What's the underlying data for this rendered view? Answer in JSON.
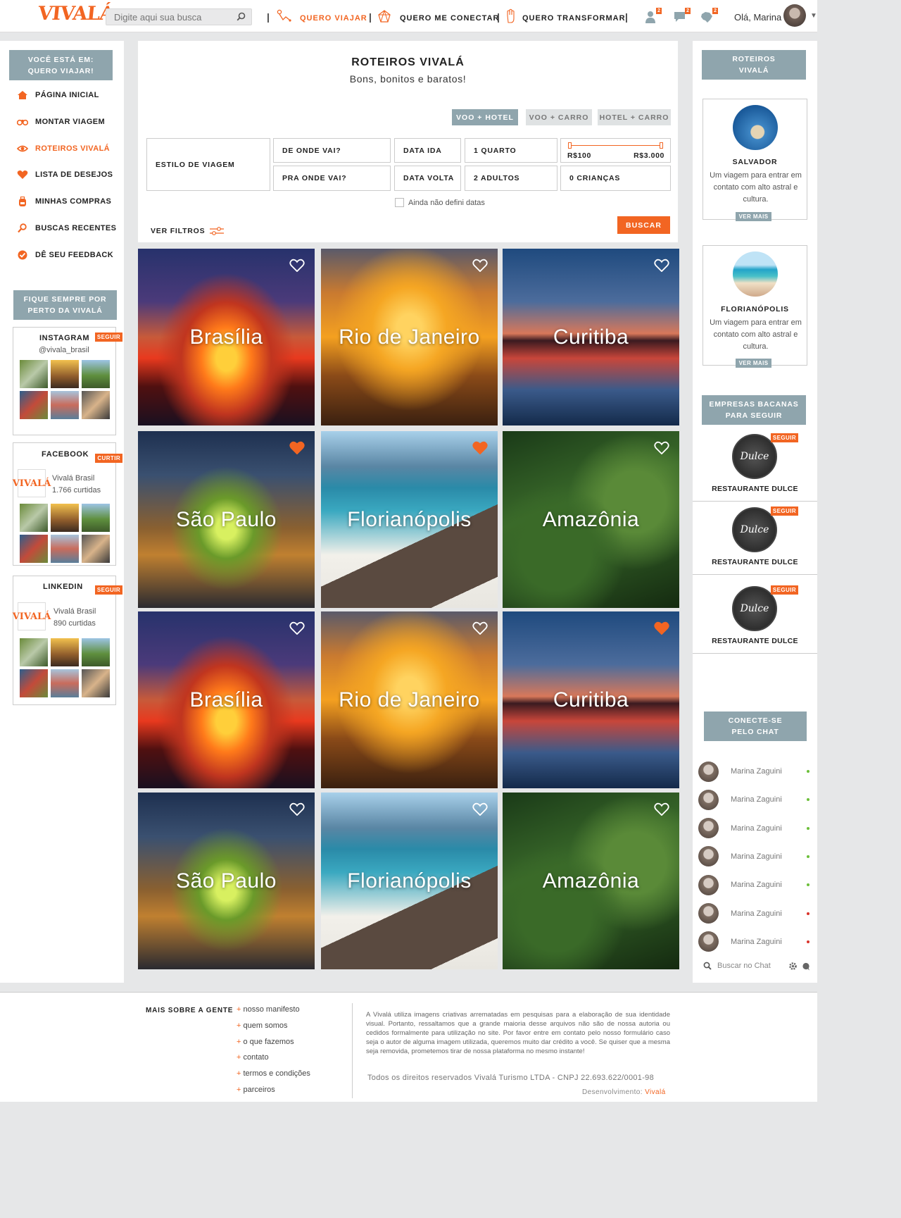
{
  "header": {
    "logo": "VIVALÁ",
    "search_placeholder": "Digite aqui sua busca",
    "nav": [
      {
        "label": "QUERO VIAJAR",
        "active": true
      },
      {
        "label": "QUERO ME CONECTAR",
        "active": false
      },
      {
        "label": "QUERO TRANSFORMAR",
        "active": false
      }
    ],
    "badges": [
      "2",
      "2",
      "2"
    ],
    "greeting": "Olá, Marina"
  },
  "left_sidebar": {
    "location_box": [
      "VOCÊ ESTÁ EM:",
      "QUERO VIAJAR!"
    ],
    "menu": [
      {
        "label": "PÁGINA INICIAL",
        "icon": "home-icon",
        "active": false
      },
      {
        "label": "MONTAR VIAGEM",
        "icon": "binoculars-icon",
        "active": false
      },
      {
        "label": "ROTEIROS VIVALÁ",
        "icon": "eye-icon",
        "active": true
      },
      {
        "label": "LISTA DE DESEJOS",
        "icon": "heart-icon",
        "active": false
      },
      {
        "label": "MINHAS COMPRAS",
        "icon": "backpack-icon",
        "active": false
      },
      {
        "label": "BUSCAS RECENTES",
        "icon": "search-icon",
        "active": false
      },
      {
        "label": "DÊ SEU FEEDBACK",
        "icon": "check-circle-icon",
        "active": false
      }
    ],
    "follow_box": [
      "FIQUE SEMPRE POR",
      "PERTO DA VIVALÁ"
    ],
    "instagram": {
      "title": "INSTAGRAM",
      "button": "SEGUIR",
      "handle": "@vivala_brasil"
    },
    "facebook": {
      "title": "FACEBOOK",
      "button": "CURTIR",
      "name": "Vivalá Brasil",
      "count": "1.766 curtidas",
      "logo": "VIVALÁ"
    },
    "linkedin": {
      "title": "LINKEDIN",
      "button": "SEGUIR",
      "name": "Vivalá Brasil",
      "count": "890 curtidas",
      "logo": "VIVALÁ"
    }
  },
  "main": {
    "title": "ROTEIROS VIVALÁ",
    "subtitle": "Bons, bonitos e baratos!",
    "tabs": [
      {
        "label": "VOO + HOTEL",
        "active": true
      },
      {
        "label": "VOO + CARRO",
        "active": false
      },
      {
        "label": "HOTEL + CARRO",
        "active": false
      }
    ],
    "fields": {
      "style": "ESTILO DE VIAGEM",
      "from": "DE ONDE VAI?",
      "to": "PRA ONDE VAI?",
      "date_out": "DATA IDA",
      "date_back": "DATA VOLTA",
      "rooms": "1 QUARTO",
      "adults": "2 ADULTOS",
      "children": "0 CRIANÇAS",
      "price_min": "R$100",
      "price_max": "R$3.000"
    },
    "no_dates": "Ainda não defini datas",
    "filters": "VER FILTROS",
    "search_button": "BUSCAR"
  },
  "destinations": [
    {
      "name": "Brasília",
      "fav": false
    },
    {
      "name": "Rio de Janeiro",
      "fav": false
    },
    {
      "name": "Curitiba",
      "fav": false
    },
    {
      "name": "São Paulo",
      "fav": true
    },
    {
      "name": "Florianópolis",
      "fav": true
    },
    {
      "name": "Amazônia",
      "fav": false
    },
    {
      "name": "Brasília",
      "fav": false
    },
    {
      "name": "Rio de Janeiro",
      "fav": false
    },
    {
      "name": "Curitiba",
      "fav": true
    },
    {
      "name": "São Paulo",
      "fav": false
    },
    {
      "name": "Florianópolis",
      "fav": false
    },
    {
      "name": "Amazônia",
      "fav": false
    }
  ],
  "right_sidebar": {
    "routes_box": [
      "ROTEIROS",
      "VIVALÁ"
    ],
    "routes": [
      {
        "name": "SALVADOR",
        "desc": "Um viagem para entrar em contato com alto astral e cultura.",
        "button": "VER MAIS"
      },
      {
        "name": "FLORIANÓPOLIS",
        "desc": "Um viagem para entrar em contato com alto astral e cultura.",
        "button": "VER MAIS"
      }
    ],
    "companies_box": [
      "EMPRESAS BACANAS",
      "PARA SEGUIR"
    ],
    "companies": [
      {
        "name": "RESTAURANTE DULCE",
        "button": "SEGUIR",
        "logo": "Dulce"
      },
      {
        "name": "RESTAURANTE DULCE",
        "button": "SEGUIR",
        "logo": "Dulce"
      },
      {
        "name": "RESTAURANTE DULCE",
        "button": "SEGUIR",
        "logo": "Dulce"
      }
    ],
    "chat_box": [
      "CONECTE-SE",
      "PELO CHAT"
    ],
    "chat_users": [
      {
        "name": "Marina Zaguini",
        "online": true
      },
      {
        "name": "Marina Zaguini",
        "online": true
      },
      {
        "name": "Marina Zaguini",
        "online": true
      },
      {
        "name": "Marina Zaguini",
        "online": true
      },
      {
        "name": "Marina Zaguini",
        "online": true
      },
      {
        "name": "Marina Zaguini",
        "online": false
      },
      {
        "name": "Marina Zaguini",
        "online": false
      }
    ],
    "chat_search": "Buscar no Chat"
  },
  "footer": {
    "title": "MAIS SOBRE A GENTE",
    "links": [
      "nosso manifesto",
      "quem somos",
      "o que fazemos",
      "contato",
      "termos e condições",
      "parceiros"
    ],
    "disclaimer": "A Vivalá utiliza imagens criativas arrematadas em pesquisas para a elaboração de sua identidade visual. Portanto, ressaltamos que a grande maioria desse arquivos não são de nossa autoria ou cedidos formalmente para utilização no site. Por favor entre em contato pelo nosso formulário caso seja o autor de alguma imagem utilizada, queremos muito dar crédito a você. Se quiser que a mesma seja removida, prometemos tirar de nossa plataforma no mesmo instante!",
    "copyright": "Todos os direitos reservados Vivalá Turismo LTDA   -   CNPJ 22.693.622/0001-98",
    "dev_label": "Desenvolvimento:",
    "dev_name": "Vivalá"
  },
  "colors": {
    "accent": "#f26522",
    "slate": "#8fa5ad",
    "online": "#6cbf3a",
    "offline": "#d9342b"
  }
}
